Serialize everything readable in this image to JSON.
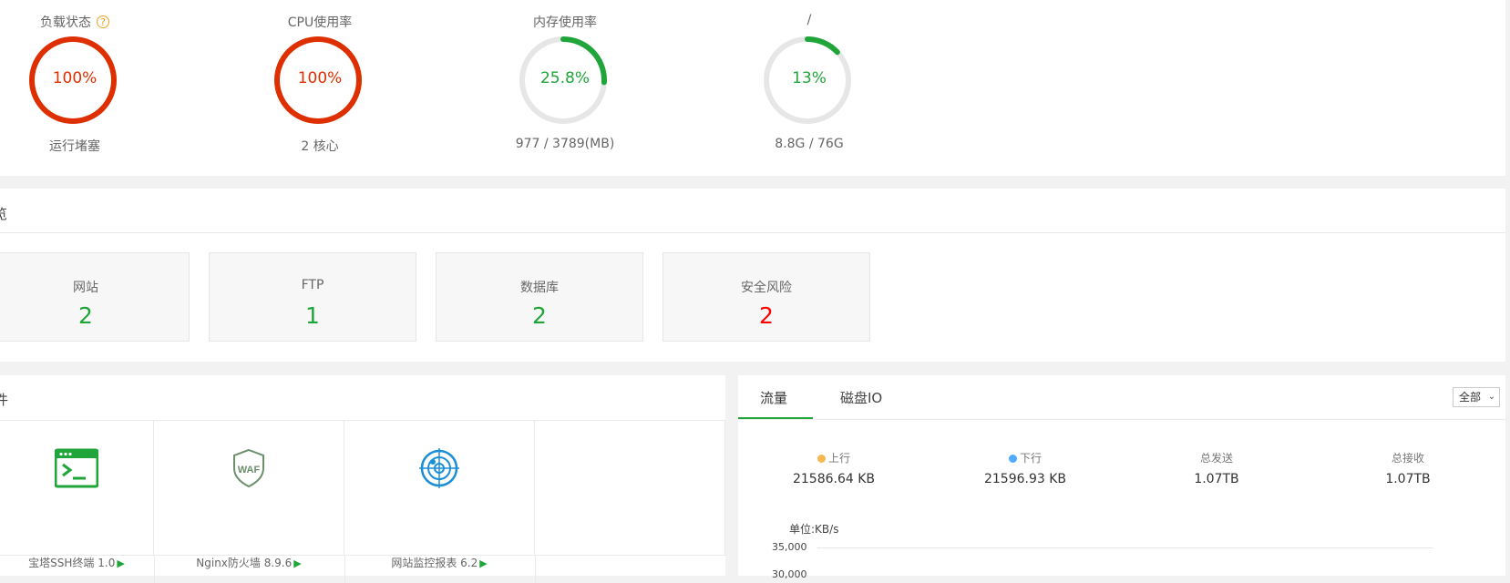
{
  "status": {
    "gauges": [
      {
        "title": "负载状态",
        "value": "100%",
        "desc": "运行堵塞",
        "percent": 100,
        "color": "#dd2f00",
        "has_help": true,
        "help_glyph": "?"
      },
      {
        "title": "CPU使用率",
        "value": "100%",
        "desc": "2 核心",
        "percent": 100,
        "color": "#dd2f00",
        "has_help": false
      },
      {
        "title": "内存使用率",
        "value": "25.8%",
        "desc": "977 / 3789(MB)",
        "percent": 25.8,
        "color": "#20a53a",
        "has_help": false
      },
      {
        "title": "/",
        "value": "13%",
        "desc": "8.8G / 76G",
        "percent": 13,
        "color": "#20a53a",
        "has_help": false
      }
    ]
  },
  "overview": {
    "title": "览",
    "boxes": [
      {
        "label": "网站",
        "value": "2",
        "color": "#20a53a"
      },
      {
        "label": "FTP",
        "value": "1",
        "color": "#20a53a"
      },
      {
        "label": "数据库",
        "value": "2",
        "color": "#20a53a"
      },
      {
        "label": "安全风险",
        "value": "2",
        "color": "#ff0000"
      }
    ]
  },
  "software": {
    "title": "件",
    "items": [
      {
        "name": "宝塔SSH终端 1.0",
        "icon": "terminal-icon"
      },
      {
        "name": "Nginx防火墙 8.9.6",
        "icon": "waf-shield-icon",
        "icon_text": "WAF"
      },
      {
        "name": "网站监控报表 6.2",
        "icon": "radar-monitor-icon"
      }
    ],
    "play_glyph": "▶"
  },
  "traffic": {
    "tabs": [
      "流量",
      "磁盘IO"
    ],
    "active_tab": 0,
    "range": {
      "selected": "全部",
      "chevron": "⌄"
    },
    "stats": [
      {
        "label": "上行",
        "value": "21586.64 KB",
        "dot_color": "#f7b851"
      },
      {
        "label": "下行",
        "value": "21596.93 KB",
        "dot_color": "#52a9ff"
      },
      {
        "label": "总发送",
        "value": "1.07TB"
      },
      {
        "label": "总接收",
        "value": "1.07TB"
      }
    ],
    "unit": "单位:KB/s",
    "yticks": [
      "35,000",
      "30,000"
    ]
  }
}
